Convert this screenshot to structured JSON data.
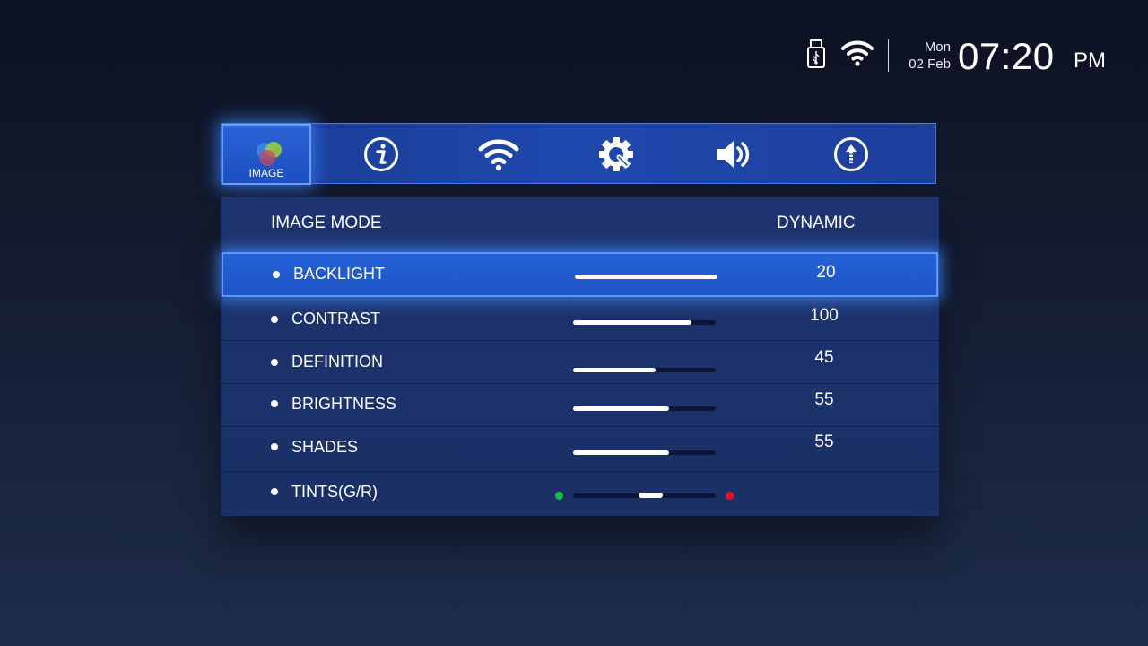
{
  "status": {
    "icons": [
      "usb-icon",
      "wifi-icon"
    ],
    "day": "Mon",
    "date": "02 Feb",
    "time": "07:20",
    "ampm": "PM"
  },
  "tabs": [
    {
      "name": "image",
      "icon": "color-circles-icon",
      "label": "IMAGE",
      "active": true
    },
    {
      "name": "info",
      "icon": "info-icon"
    },
    {
      "name": "wifi",
      "icon": "wifi-icon"
    },
    {
      "name": "settings",
      "icon": "gear-wrench-icon"
    },
    {
      "name": "sound",
      "icon": "speaker-icon"
    },
    {
      "name": "update",
      "icon": "upload-icon"
    }
  ],
  "panel": {
    "mode_label": "IMAGE MODE",
    "mode_value": "DYNAMIC",
    "rows": [
      {
        "label": "BACKLIGHT",
        "value": "20",
        "level": 1.0
      },
      {
        "label": "CONTRAST",
        "value": "100",
        "level": 0.83
      },
      {
        "label": "DEFINITION",
        "value": "45",
        "level": 0.58
      },
      {
        "label": "BRIGHTNESS",
        "value": "55",
        "level": 0.67
      },
      {
        "label": "SHADES",
        "value": "55",
        "level": 0.67
      },
      {
        "label": "TINTS(G/R)",
        "value": "",
        "tint_position": 0.5
      }
    ]
  },
  "colors": {
    "accent": "#1e55c8",
    "tint_green": "#12c43a",
    "tint_red": "#e1141e"
  }
}
